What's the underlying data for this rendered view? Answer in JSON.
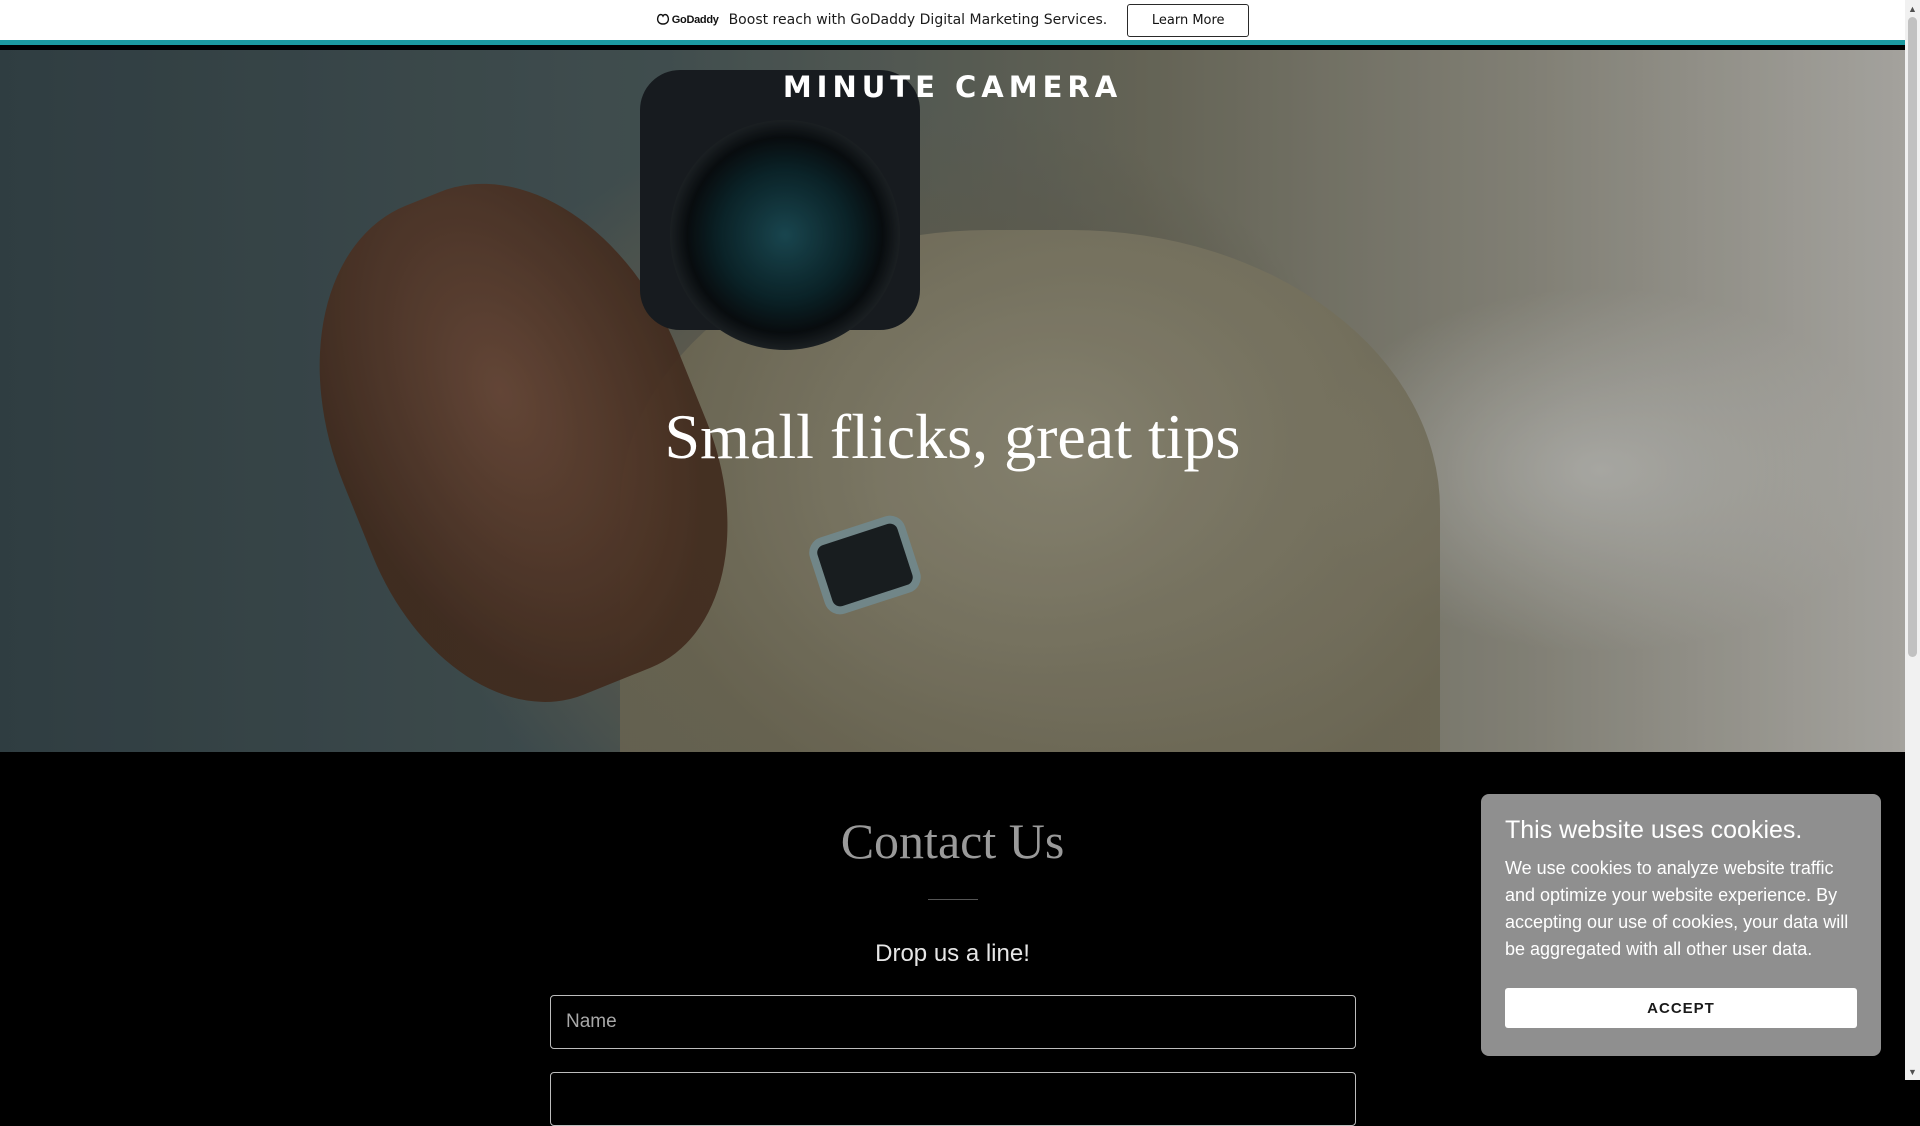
{
  "promo": {
    "logo_text": "GoDaddy",
    "message": "Boost reach with GoDaddy Digital Marketing Services.",
    "button_label": "Learn More",
    "accent_color": "#1c9aa0"
  },
  "hero": {
    "site_title": "MINUTE CAMERA",
    "tagline": "Small flicks, great tips"
  },
  "contact": {
    "title": "Contact Us",
    "subtitle": "Drop us a line!",
    "name_placeholder": "Name",
    "email_placeholder": ""
  },
  "cookie": {
    "title": "This website uses cookies.",
    "body": "We use cookies to analyze website traffic and optimize your website experience. By accepting our use of cookies, your data will be aggregated with all other user data.",
    "accept_label": "ACCEPT"
  },
  "icons": {
    "logo": "godaddy-logo-icon",
    "scroll_up": "scroll-up-arrow",
    "scroll_down": "scroll-down-arrow"
  }
}
